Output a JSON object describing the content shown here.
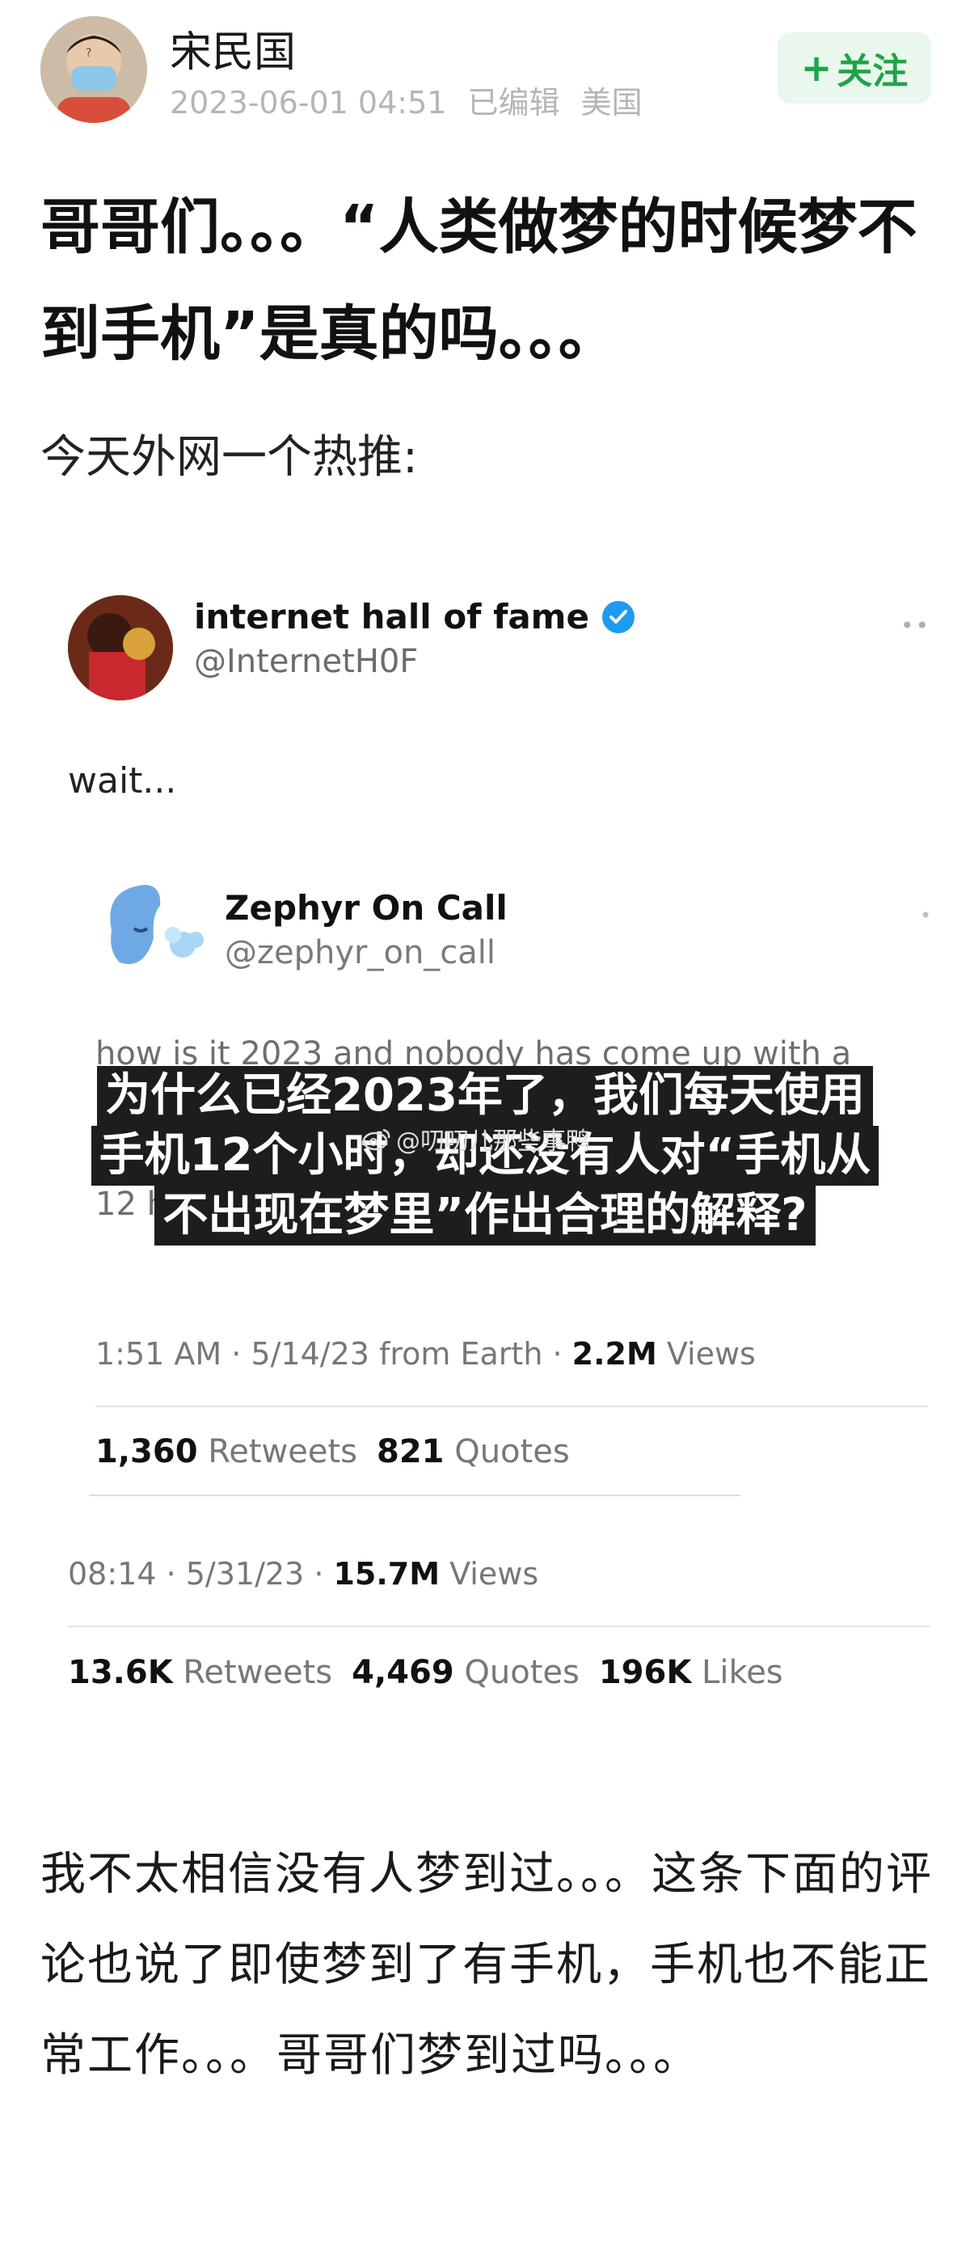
{
  "post": {
    "author": "宋民国",
    "date": "2023-06-01 04:51",
    "edited": "已编辑",
    "location": "美国",
    "follow_label": "关注",
    "title": "哥哥们。。。“人类做梦的时候梦不到手机”是真的吗。。。",
    "intro": "今天外网一个热推:",
    "body": "我不太相信没有人梦到过。。。这条下面的评论也说了即使梦到了有手机，手机也不能正常工作。。。哥哥们梦到过吗。。。"
  },
  "tweet": {
    "name": "internet hall of fame",
    "handle": "@InternetH0F",
    "text": "wait...",
    "time": "08:14 · 5/31/23 · ",
    "views_value": "15.7M",
    "views_label": " Views",
    "retweets_value": "13.6K",
    "retweets_label": " Retweets",
    "quotes_value": "4,469",
    "quotes_label": " Quotes",
    "likes_value": "196K",
    "likes_label": " Likes",
    "more": "••"
  },
  "quoted": {
    "name": "Zephyr On Call",
    "handle": "@zephyr_on_call",
    "hidden_text": "how is it 2023 and nobody has come up with a reasonable explanation for why phones never appear in dreams even though we use them for 12 hours a day?",
    "time": "1:51 AM · 5/14/23 from Earth · ",
    "views_value": "2.2M",
    "views_label": " Views",
    "retweets_value": "1,360",
    "retweets_label": " Retweets",
    "quotes_value": "821",
    "quotes_label": " Quotes",
    "more": "•"
  },
  "overlay": {
    "line1": "为什么已经2023年了，我们每天使用",
    "line2": "手机12个小时，却还没有人对“手机从",
    "line3": "不出现在梦里”作出合理的解释?",
    "watermark": "@叨叨儿那些事鸭"
  },
  "colors": {
    "follow_bg": "#e9f7ec",
    "follow_text": "#1fa34a",
    "verified": "#1d9bf0",
    "meta_gray": "#b5b5b5"
  }
}
